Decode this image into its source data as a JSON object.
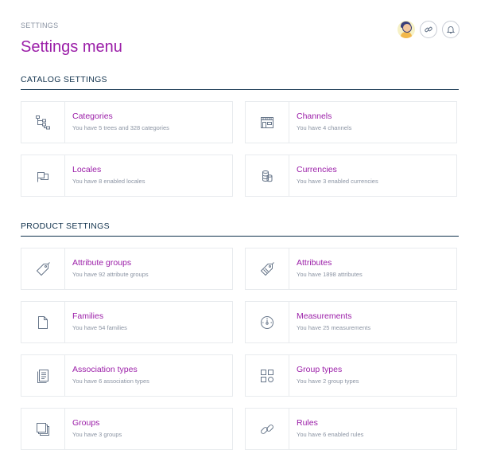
{
  "breadcrumb": "SETTINGS",
  "page_title": "Settings menu",
  "sections": [
    {
      "title": "CATALOG SETTINGS"
    },
    {
      "title": "PRODUCT SETTINGS"
    }
  ],
  "tiles": [
    {
      "label": "Categories",
      "desc": "You have 5 trees and 328 categories",
      "icon": "category-tree-icon"
    },
    {
      "label": "Channels",
      "desc": "You have 4 channels",
      "icon": "shop-icon"
    },
    {
      "label": "Locales",
      "desc": "You have 8 enabled locales",
      "icon": "flag-icon"
    },
    {
      "label": "Currencies",
      "desc": "You have 3 enabled currencies",
      "icon": "coins-icon"
    },
    {
      "label": "Attribute groups",
      "desc": "You have 92 attribute groups",
      "icon": "tag-icon"
    },
    {
      "label": "Attributes",
      "desc": "You have 1898 attributes",
      "icon": "tags-icon"
    },
    {
      "label": "Families",
      "desc": "You have 54 families",
      "icon": "document-icon"
    },
    {
      "label": "Measurements",
      "desc": "You have 25 measurements",
      "icon": "gauge-icon"
    },
    {
      "label": "Association types",
      "desc": "You have 6 association types",
      "icon": "stacked-documents-icon"
    },
    {
      "label": "Group types",
      "desc": "You have 2 group types",
      "icon": "shapes-icon"
    },
    {
      "label": "Groups",
      "desc": "You have 3 groups",
      "icon": "stacked-squares-icon"
    },
    {
      "label": "Rules",
      "desc": "You have 6 enabled rules",
      "icon": "link-icon"
    }
  ],
  "colors": {
    "accent": "#9b1ea8",
    "heading": "#11324d",
    "text": "#8b94a3",
    "border": "#e8ebee"
  }
}
